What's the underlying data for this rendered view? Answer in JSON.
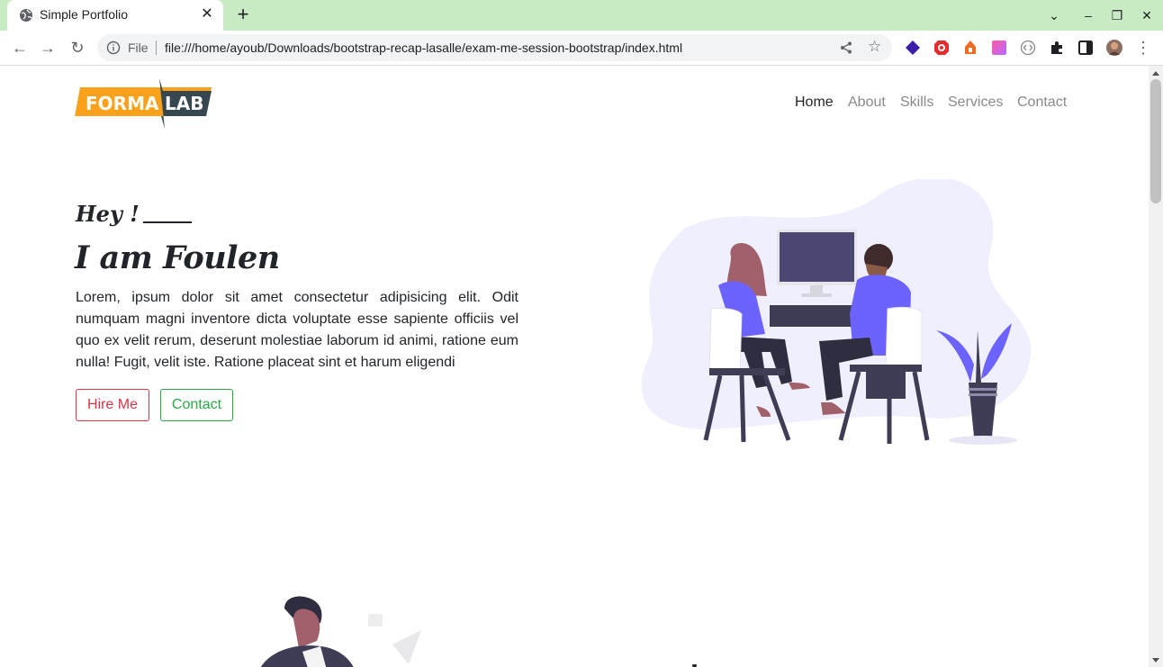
{
  "browser": {
    "tab_title": "Simple Portfolio",
    "url_scheme_label": "File",
    "url": "file:///home/ayoub/Downloads/bootstrap-recap-lasalle/exam-me-session-bootstrap/index.html"
  },
  "site": {
    "logo": {
      "part1": "FORMA",
      "part2": "LAB"
    },
    "nav": [
      "Home",
      "About",
      "Skills",
      "Services",
      "Contact"
    ],
    "active_nav": "Home",
    "hero": {
      "greeting": "Hey !",
      "headline": "I am Foulen",
      "paragraph": "Lorem, ipsum dolor sit amet consectetur adipisicing elit. Odit numquam magni inventore dicta voluptate esse sapiente officiis vel quo ex velit rerum, deserunt molestiae laborum id animi, ratione eum nulla! Fugit, velit iste. Ratione placeat sint et harum eligendi",
      "hire_button": "Hire Me",
      "contact_button": "Contact"
    }
  },
  "colors": {
    "tab_strip": "#c9ebc3",
    "logo_orange": "#f9a11b",
    "logo_dark": "#37474f",
    "hire_red": "#dc3545",
    "contact_green": "#28a745",
    "illustration_purple": "#6c63ff",
    "illustration_blob": "#efeffd"
  }
}
